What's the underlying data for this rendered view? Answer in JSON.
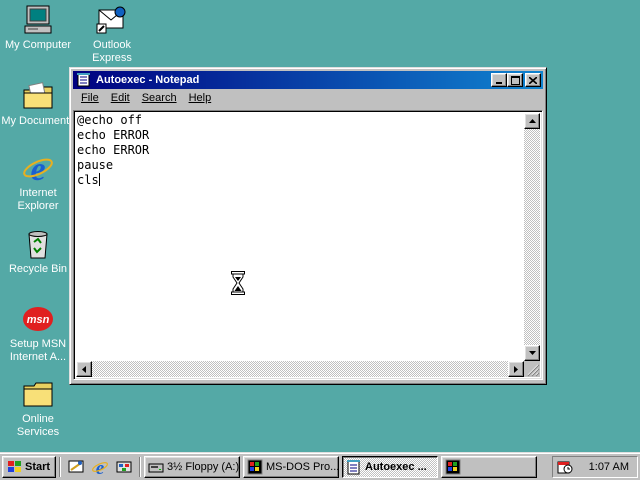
{
  "desktop": {
    "background": "#54a9a6",
    "icons": [
      {
        "label": "My Computer",
        "icon": "my-computer-icon"
      },
      {
        "label": "Outlook Express",
        "icon": "outlook-express-icon"
      },
      {
        "label": "My Documents",
        "icon": "folder-documents-icon"
      },
      {
        "label": "Internet Explorer",
        "icon": "internet-explorer-icon"
      },
      {
        "label": "Recycle Bin",
        "icon": "recycle-bin-icon"
      },
      {
        "label": "Setup MSN Internet A...",
        "icon": "msn-icon"
      },
      {
        "label": "Online Services",
        "icon": "folder-icon"
      }
    ]
  },
  "notepad": {
    "title": "Autoexec - Notepad",
    "menu": {
      "file": "File",
      "edit": "Edit",
      "search": "Search",
      "help": "Help"
    },
    "content_lines": [
      "@echo off",
      "echo ERROR",
      "echo ERROR",
      "pause",
      "cls"
    ]
  },
  "taskbar": {
    "start_label": "Start",
    "quick_launch": [
      "show-desktop-icon",
      "internet-explorer-icon",
      "channels-icon"
    ],
    "buttons": [
      {
        "label": "3½ Floppy (A:)",
        "icon": "floppy-drive-icon",
        "active": false
      },
      {
        "label": "MS-DOS Pro...",
        "icon": "ms-dos-icon",
        "active": false
      },
      {
        "label": "Autoexec ...",
        "icon": "notepad-icon",
        "active": true
      },
      {
        "label": "",
        "icon": "ms-dos-icon",
        "active": false
      }
    ],
    "clock": "1:07 AM",
    "tray_icon": "scheduler-icon"
  },
  "colors": {
    "titlebar_start": "#000080",
    "titlebar_end": "#1084d0",
    "face": "#c0c0c0"
  }
}
